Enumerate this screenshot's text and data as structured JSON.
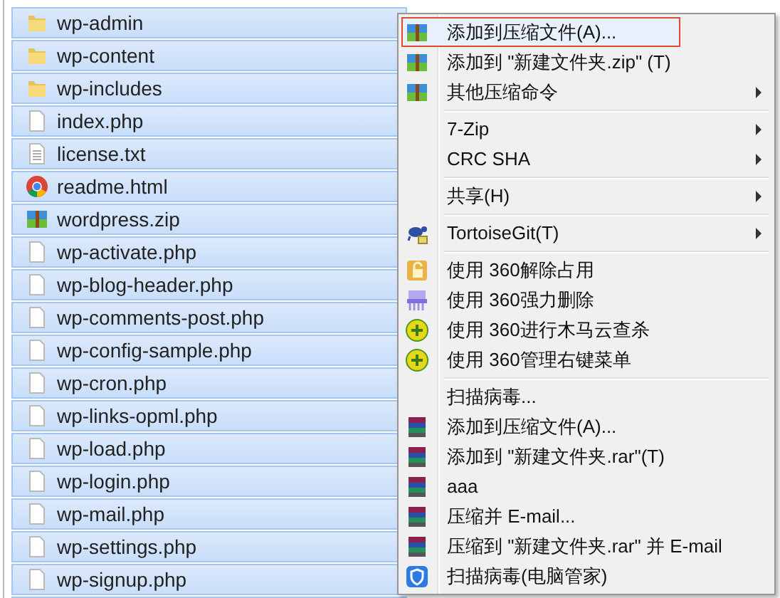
{
  "files": [
    {
      "name": "wp-admin",
      "kind": "folder",
      "selected": true
    },
    {
      "name": "wp-content",
      "kind": "folder",
      "selected": true
    },
    {
      "name": "wp-includes",
      "kind": "folder",
      "selected": true
    },
    {
      "name": "index.php",
      "kind": "file",
      "selected": true
    },
    {
      "name": "license.txt",
      "kind": "text",
      "selected": true
    },
    {
      "name": "readme.html",
      "kind": "browser",
      "selected": true
    },
    {
      "name": "wordpress.zip",
      "kind": "archive",
      "selected": true
    },
    {
      "name": "wp-activate.php",
      "kind": "file",
      "selected": true
    },
    {
      "name": "wp-blog-header.php",
      "kind": "file",
      "selected": true
    },
    {
      "name": "wp-comments-post.php",
      "kind": "file",
      "selected": true
    },
    {
      "name": "wp-config-sample.php",
      "kind": "file",
      "selected": true
    },
    {
      "name": "wp-cron.php",
      "kind": "file",
      "selected": true
    },
    {
      "name": "wp-links-opml.php",
      "kind": "file",
      "selected": true
    },
    {
      "name": "wp-load.php",
      "kind": "file",
      "selected": true
    },
    {
      "name": "wp-login.php",
      "kind": "file",
      "selected": true
    },
    {
      "name": "wp-mail.php",
      "kind": "file",
      "selected": true
    },
    {
      "name": "wp-settings.php",
      "kind": "file",
      "selected": true
    },
    {
      "name": "wp-signup.php",
      "kind": "file",
      "selected": true
    }
  ],
  "context_menu": [
    {
      "kind": "archive",
      "label": "添加到压缩文件(A)...",
      "submenu": false,
      "selected": true
    },
    {
      "kind": "archive",
      "label": "添加到 \"新建文件夹.zip\" (T)",
      "submenu": false,
      "selected": false
    },
    {
      "kind": "archive",
      "label": "其他压缩命令",
      "submenu": true,
      "selected": false
    },
    {
      "kind": "separator"
    },
    {
      "kind": "plain",
      "label": "7-Zip",
      "submenu": true,
      "selected": false
    },
    {
      "kind": "plain",
      "label": "CRC SHA",
      "submenu": true,
      "selected": false
    },
    {
      "kind": "separator"
    },
    {
      "kind": "plain",
      "label": "共享(H)",
      "submenu": true,
      "selected": false
    },
    {
      "kind": "separator"
    },
    {
      "kind": "tortoise",
      "label": "TortoiseGit(T)",
      "submenu": true,
      "selected": false
    },
    {
      "kind": "separator"
    },
    {
      "kind": "unlock",
      "label": "使用 360解除占用",
      "submenu": false,
      "selected": false
    },
    {
      "kind": "shredder",
      "label": "使用 360强力删除",
      "submenu": false,
      "selected": false
    },
    {
      "kind": "plus",
      "label": "使用 360进行木马云查杀",
      "submenu": false,
      "selected": false
    },
    {
      "kind": "plus",
      "label": "使用 360管理右键菜单",
      "submenu": false,
      "selected": false
    },
    {
      "kind": "separator"
    },
    {
      "kind": "plain",
      "label": "扫描病毒...",
      "submenu": false,
      "selected": false
    },
    {
      "kind": "books",
      "label": "添加到压缩文件(A)...",
      "submenu": false,
      "selected": false
    },
    {
      "kind": "books",
      "label": "添加到 \"新建文件夹.rar\"(T)",
      "submenu": false,
      "selected": false
    },
    {
      "kind": "books",
      "label": "aaa",
      "submenu": false,
      "selected": false
    },
    {
      "kind": "books",
      "label": "压缩并 E-mail...",
      "submenu": false,
      "selected": false
    },
    {
      "kind": "books",
      "label": "压缩到 \"新建文件夹.rar\" 并 E-mail",
      "submenu": false,
      "selected": false
    },
    {
      "kind": "shield",
      "label": "扫描病毒(电脑管家)",
      "submenu": false,
      "selected": false
    }
  ]
}
